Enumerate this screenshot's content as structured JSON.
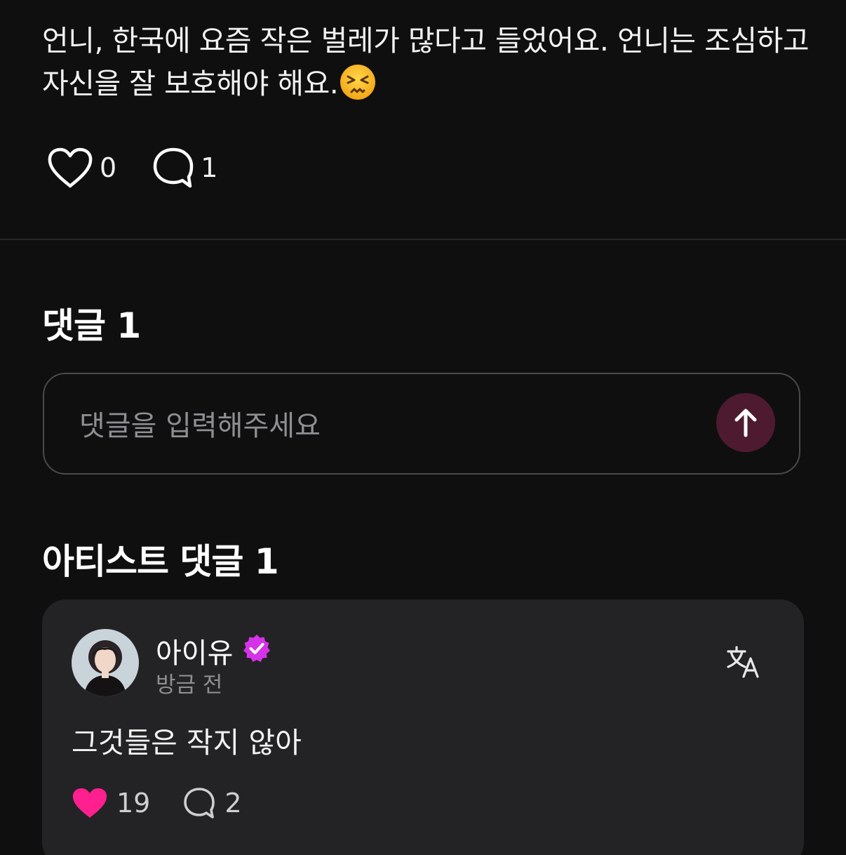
{
  "post": {
    "text": "언니, 한국에 요즘 작은 벌레가 많다고 들었어요. 언니는 조심하고 자신을 잘 보호해야 해요.",
    "emoji": "persevering-face-emoji",
    "likes": "0",
    "comments": "1"
  },
  "comments_section": {
    "title": "댓글 1",
    "input_placeholder": "댓글을 입력해주세요"
  },
  "artist_section": {
    "title": "아티스트 댓글 1",
    "comment": {
      "author": "아이유",
      "time": "방금 전",
      "text": "그것들은 작지 않아",
      "likes": "19",
      "replies": "2"
    }
  },
  "colors": {
    "background": "#0f0f10",
    "card": "#232325",
    "like_active": "#ff1f8e",
    "verified": "#d633e8",
    "send_button": "#4e1a30"
  },
  "icons": [
    "heart-outline-icon",
    "chat-bubble-icon",
    "arrow-up-icon",
    "verified-badge-icon",
    "translate-icon",
    "heart-filled-icon"
  ]
}
